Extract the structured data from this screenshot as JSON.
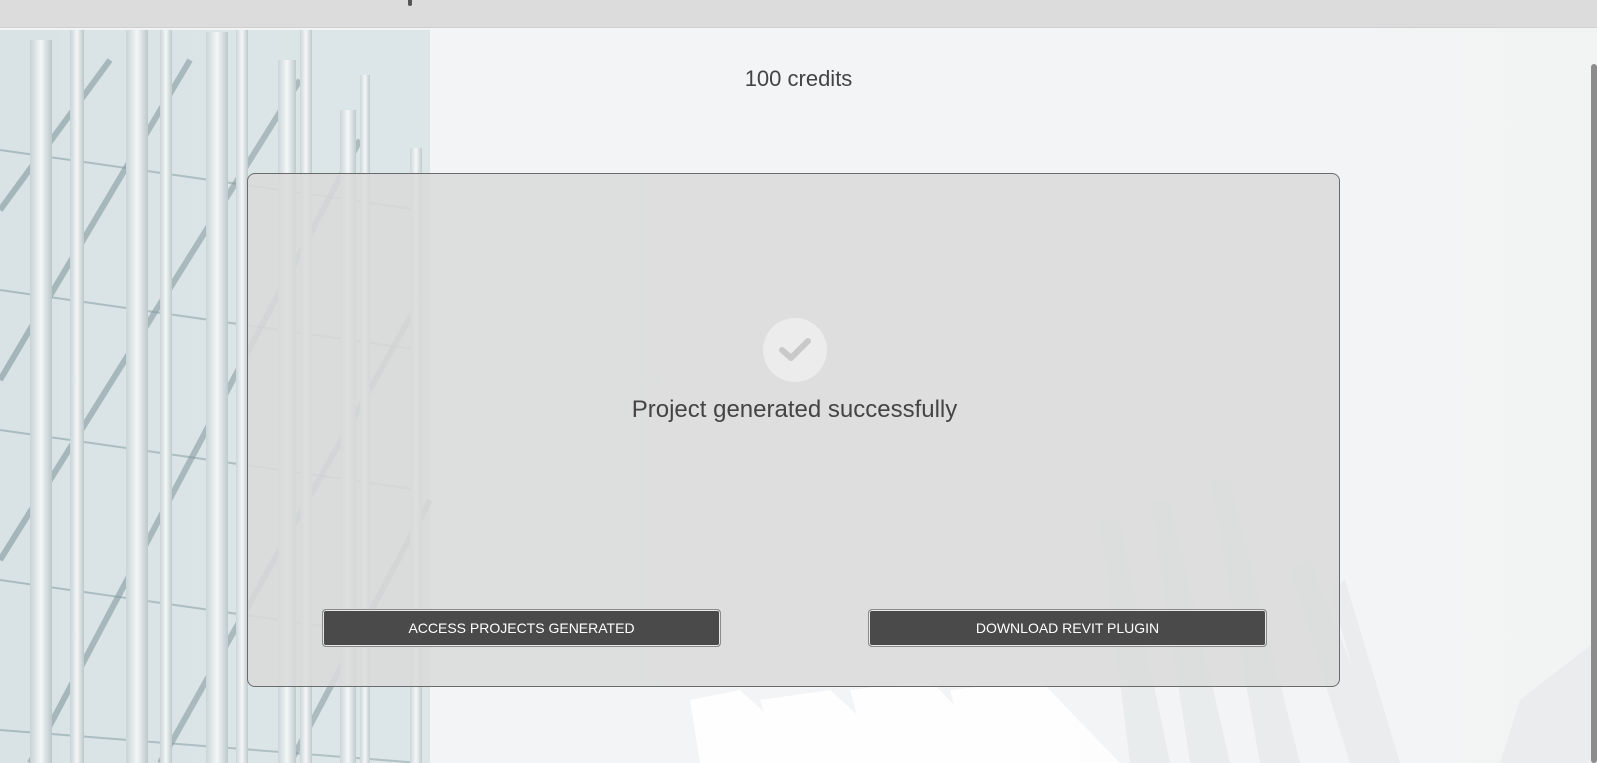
{
  "header": {
    "credits_text": "100 credits"
  },
  "panel": {
    "status_icon": "check-circle-icon",
    "status_text": "Project generated successfully",
    "buttons": {
      "access_label": "ACCESS PROJECTS GENERATED",
      "download_label": "DOWNLOAD REVIT PLUGIN"
    }
  },
  "colors": {
    "button_bg": "#4a4a4a",
    "panel_bg": "#dadada",
    "text": "#444444"
  }
}
